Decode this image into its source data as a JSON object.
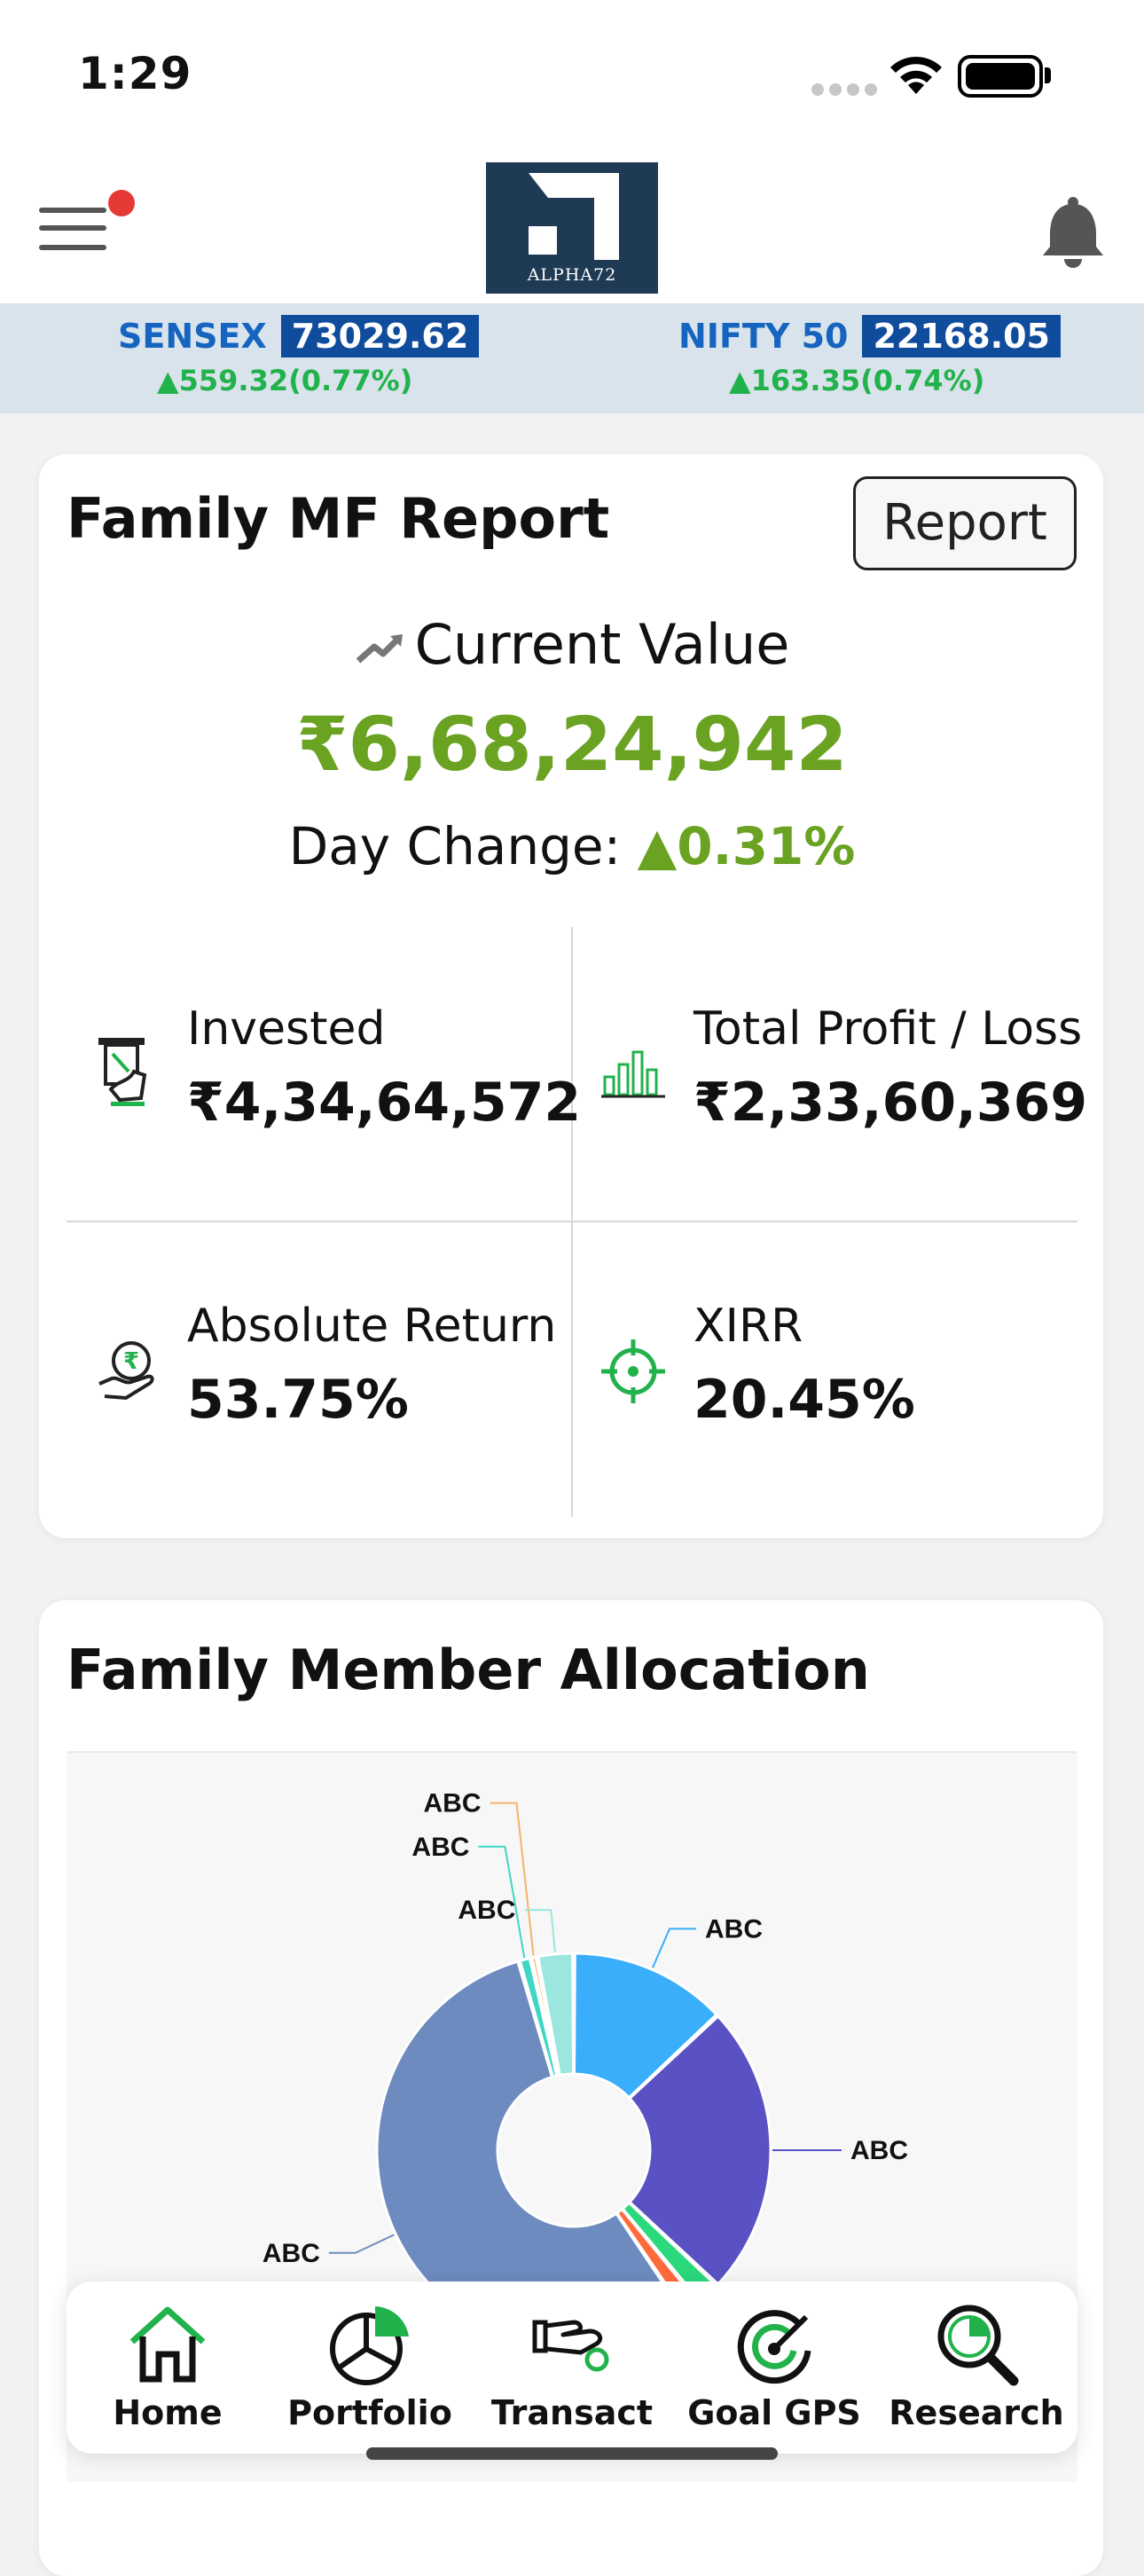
{
  "status_bar": {
    "time": "1:29"
  },
  "header": {
    "logo_text": "ALPHA72",
    "menu_has_notification": true
  },
  "ticker": {
    "sensex": {
      "name": "SENSEX",
      "value": "73029.62",
      "change": "▲559.32(0.77%)"
    },
    "nifty": {
      "name": "NIFTY 50",
      "value": "22168.05",
      "change": "▲163.35(0.74%)"
    }
  },
  "mf_report": {
    "title": "Family MF Report",
    "report_button": "Report",
    "current_value_label": "Current Value",
    "current_value": "₹6,68,24,942",
    "day_change_label": "Day Change:",
    "day_change_value": "▲0.31%",
    "stats": {
      "invested": {
        "label": "Invested",
        "value": "₹4,34,64,572"
      },
      "profit": {
        "label": "Total Profit / Loss",
        "value": "₹2,33,60,369"
      },
      "absolute": {
        "label": "Absolute Return",
        "value": "53.75%"
      },
      "xirr": {
        "label": "XIRR",
        "value": "20.45%"
      }
    }
  },
  "allocation": {
    "title": "Family Member Allocation"
  },
  "chart_data": {
    "type": "pie",
    "title": "Family Member Allocation",
    "donut": true,
    "slices": [
      {
        "label": "ABC",
        "value": 13,
        "color": "#3aaefb"
      },
      {
        "label": "ABC",
        "value": 24,
        "color": "#5a52c4"
      },
      {
        "label": "",
        "value": 2,
        "color": "#2bd97c"
      },
      {
        "label": "",
        "value": 1.5,
        "color": "#ff6a3d"
      },
      {
        "label": "ABC",
        "value": 55,
        "color": "#6e8bbf"
      },
      {
        "label": "ABC",
        "value": 1,
        "color": "#3fd6c4"
      },
      {
        "label": "ABC",
        "value": 0.5,
        "color": "#f4b36b"
      },
      {
        "label": "ABC",
        "value": 3,
        "color": "#9be6df"
      }
    ]
  },
  "bottom_nav": {
    "items": [
      {
        "label": "Home",
        "icon": "home-icon"
      },
      {
        "label": "Portfolio",
        "icon": "portfolio-pie-icon"
      },
      {
        "label": "Transact",
        "icon": "transact-hand-icon"
      },
      {
        "label": "Goal GPS",
        "icon": "goal-gps-icon"
      },
      {
        "label": "Research",
        "icon": "research-magnifier-icon"
      }
    ]
  },
  "colors": {
    "accent_green": "#6aa222",
    "brand_navy": "#1f3a55",
    "ticker_blue": "#0f4c9c",
    "positive": "#22b24c"
  }
}
